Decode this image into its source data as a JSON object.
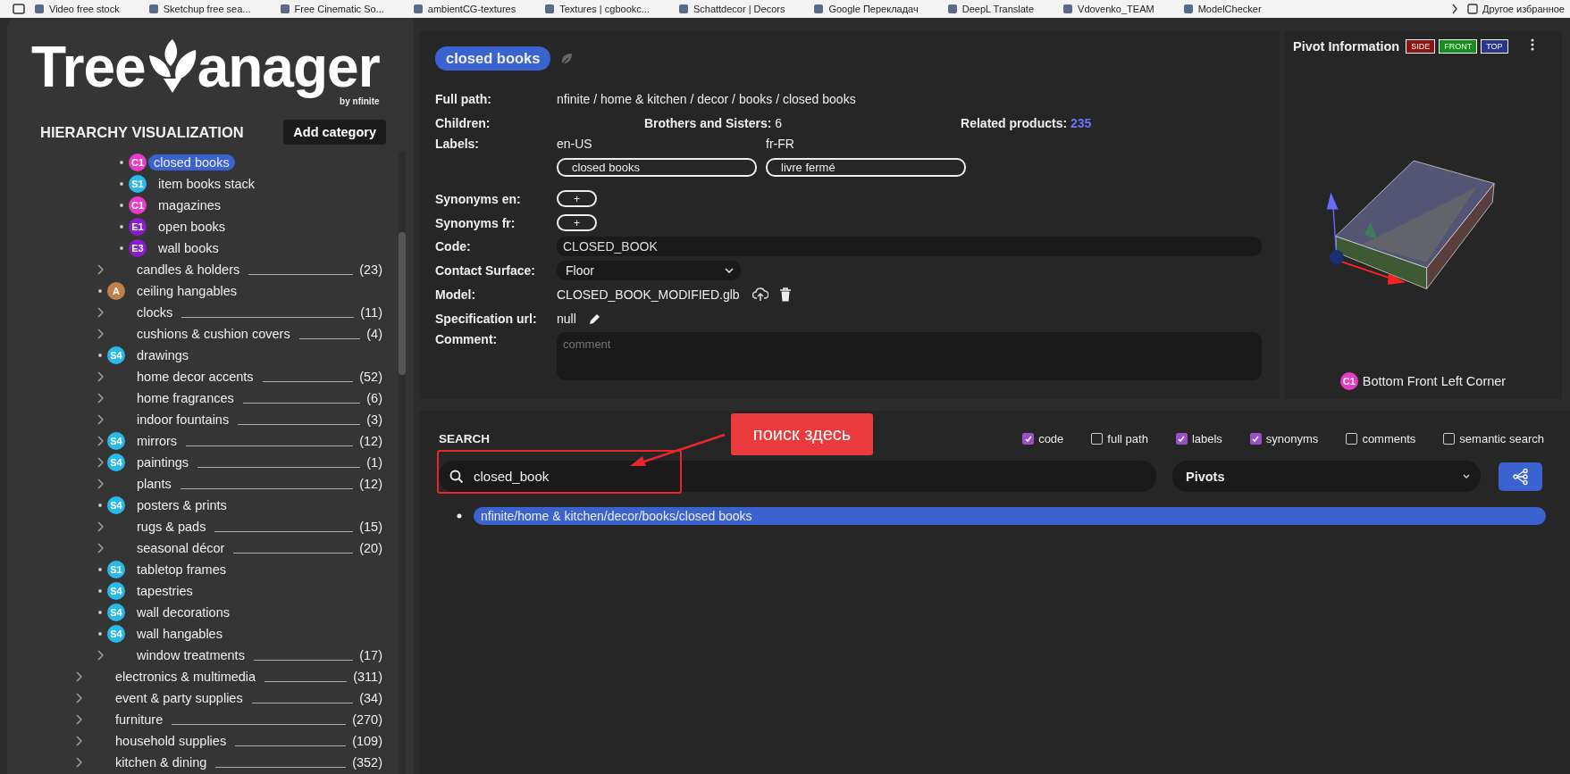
{
  "bookmarks_bar": {
    "items": [
      {
        "label": "Video free stock"
      },
      {
        "label": "Sketchup free sea..."
      },
      {
        "label": "Free Cinematic So..."
      },
      {
        "label": "ambientCG-textures"
      },
      {
        "label": "Textures | cgbookc..."
      },
      {
        "label": "Schattdecor | Decors"
      },
      {
        "label": "Google Перекладач"
      },
      {
        "label": "DeepL Translate"
      },
      {
        "label": "Vdovenko_TEAM"
      },
      {
        "label": "ModelChecker"
      }
    ],
    "other": "Другое избранное"
  },
  "logo": {
    "part_1": "Tree",
    "part_2": "anager",
    "tagline": "by nfinite"
  },
  "sidebar": {
    "title": "HIERARCHY VISUALIZATION",
    "add_button": "Add category",
    "tree": [
      {
        "children": [
          {
            "children": [
              {
                "label": "closed books",
                "kind": "leaf",
                "selected": true,
                "badge": {
                  "text": "C1",
                  "color": "#e83cc8"
                }
              },
              {
                "label": "item books stack",
                "kind": "leaf",
                "selected": false,
                "badge": {
                  "text": "S1",
                  "color": "#2bb8ea"
                }
              },
              {
                "label": "magazines",
                "kind": "leaf",
                "selected": false,
                "badge": {
                  "text": "C1",
                  "color": "#e83cc8"
                }
              },
              {
                "label": "open books",
                "kind": "leaf",
                "selected": false,
                "badge": {
                  "text": "E1",
                  "color": "#8a1ccc"
                }
              },
              {
                "label": "wall books",
                "kind": "leaf",
                "selected": false,
                "badge": {
                  "text": "E3",
                  "color": "#8a1ccc"
                }
              }
            ]
          },
          {
            "label": "candles & holders",
            "kind": "branch",
            "selected": false,
            "count": "(23)"
          },
          {
            "label": "ceiling hangables",
            "kind": "leaf",
            "selected": false,
            "badge": {
              "text": "A",
              "color": "#c0804a"
            }
          },
          {
            "label": "clocks",
            "kind": "branch",
            "selected": false,
            "count": "(11)"
          },
          {
            "label": "cushions & cushion covers",
            "kind": "branch",
            "selected": false,
            "count": "(4)"
          },
          {
            "label": "drawings",
            "kind": "leaf",
            "selected": false,
            "badge": {
              "text": "S4",
              "color": "#2bb8ea"
            }
          },
          {
            "label": "home decor accents",
            "kind": "branch",
            "selected": false,
            "count": "(52)"
          },
          {
            "label": "home fragrances",
            "kind": "branch",
            "selected": false,
            "count": "(6)"
          },
          {
            "label": "indoor fountains",
            "kind": "branch",
            "selected": false,
            "count": "(3)"
          },
          {
            "label": "mirrors",
            "kind": "branch",
            "selected": false,
            "count": "(12)",
            "badge": {
              "text": "S4",
              "color": "#2bb8ea"
            }
          },
          {
            "label": "paintings",
            "kind": "branch",
            "selected": false,
            "count": "(1)",
            "badge": {
              "text": "S4",
              "color": "#2bb8ea"
            }
          },
          {
            "label": "plants",
            "kind": "branch",
            "selected": false,
            "count": "(12)"
          },
          {
            "label": "posters & prints",
            "kind": "leaf",
            "selected": false,
            "badge": {
              "text": "S4",
              "color": "#2bb8ea"
            }
          },
          {
            "label": "rugs & pads",
            "kind": "branch",
            "selected": false,
            "count": "(15)"
          },
          {
            "label": "seasonal décor",
            "kind": "branch",
            "selected": false,
            "count": "(20)"
          },
          {
            "label": "tabletop frames",
            "kind": "leaf",
            "selected": false,
            "badge": {
              "text": "S1",
              "color": "#2bb8ea"
            }
          },
          {
            "label": "tapestries",
            "kind": "leaf",
            "selected": false,
            "badge": {
              "text": "S4",
              "color": "#2bb8ea"
            }
          },
          {
            "label": "wall decorations",
            "kind": "leaf",
            "selected": false,
            "badge": {
              "text": "S4",
              "color": "#2bb8ea"
            }
          },
          {
            "label": "wall hangables",
            "kind": "leaf",
            "selected": false,
            "badge": {
              "text": "S4",
              "color": "#2bb8ea"
            }
          },
          {
            "label": "window treatments",
            "kind": "branch",
            "selected": false,
            "count": "(17)"
          }
        ]
      },
      {
        "label": "electronics & multimedia",
        "kind": "branch",
        "selected": false,
        "count": "(311)"
      },
      {
        "label": "event & party supplies",
        "kind": "branch",
        "selected": false,
        "count": "(34)"
      },
      {
        "label": "furniture",
        "kind": "branch",
        "selected": false,
        "count": "(270)"
      },
      {
        "label": "household supplies",
        "kind": "branch",
        "selected": false,
        "count": "(109)"
      },
      {
        "label": "kitchen & dining",
        "kind": "branch",
        "selected": false,
        "count": "(352)"
      }
    ]
  },
  "detail": {
    "title": "closed books",
    "full_path_label": "Full path:",
    "full_path": "nfinite / home & kitchen / decor / books / closed books",
    "children_label": "Children:",
    "siblings_label": "Brothers and Sisters:",
    "siblings": "6",
    "related_label": "Related products:",
    "related": "235",
    "labels_label": "Labels:",
    "labels": [
      {
        "lang": "en-US",
        "value": "closed books"
      },
      {
        "lang": "fr-FR",
        "value": "livre fermé"
      }
    ],
    "synonyms": [
      {
        "label": "Synonyms en:",
        "add": "+"
      },
      {
        "label": "Synonyms fr:",
        "add": "+"
      }
    ],
    "code_label": "Code:",
    "code": "CLOSED_BOOK",
    "contact_label": "Contact Surface:",
    "contact": "Floor",
    "model_label": "Model:",
    "model": "CLOSED_BOOK_MODIFIED.glb",
    "spec_label": "Specification url:",
    "spec": "null",
    "comment_label": "Comment:",
    "comment_placeholder": "comment"
  },
  "pivot": {
    "title": "Pivot Information",
    "views": [
      {
        "label": "SIDE",
        "color": "#8e1212"
      },
      {
        "label": "FRONT",
        "color": "#13901a"
      },
      {
        "label": "TOP",
        "color": "#27358f"
      }
    ],
    "badge": {
      "text": "C1",
      "color": "#e83cc8"
    },
    "caption": "Bottom Front Left Corner"
  },
  "search": {
    "title": "SEARCH",
    "filters": [
      {
        "label": "code",
        "checked": true
      },
      {
        "label": "full path",
        "checked": false
      },
      {
        "label": "labels",
        "checked": true
      },
      {
        "label": "synonyms",
        "checked": true
      },
      {
        "label": "comments",
        "checked": false
      },
      {
        "label": "semantic search",
        "checked": false
      }
    ],
    "value": "closed_book",
    "mode": "Pivots",
    "results": [
      {
        "text": "nfinite/home & kitchen/decor/books/closed books",
        "selected": true
      }
    ],
    "annotation": "поиск здесь"
  }
}
